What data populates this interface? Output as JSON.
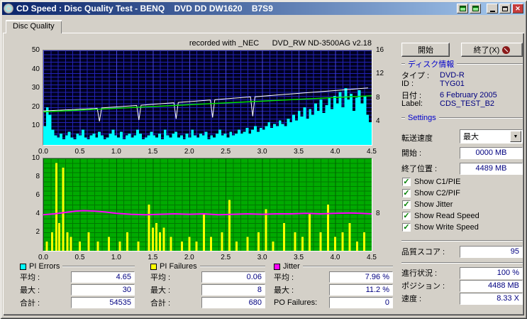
{
  "window": {
    "title": "CD Speed : Disc Quality Test - BENQ    DVD DD DW1620    B7S9",
    "tab": "Disc Quality"
  },
  "annotation": "recorded with _NEC      DVD_RW ND-3500AG v2.18",
  "icons": {
    "close": "✕",
    "check": "✓",
    "combo_arrow": "▼"
  },
  "colors": {
    "titlebar_start": "#0a246a",
    "titlebar_end": "#a6caf0",
    "face": "#d4d0c8",
    "value_navy": "#000080",
    "section_blue": "#0000cc",
    "check_green": "#008000",
    "close_red": "#c43c3c",
    "pi_errors": "#00ffff",
    "pi_failures": "#ffff00",
    "jitter": "#ff00ff",
    "read_speed": "#00e000",
    "write_speed": "#ffffff"
  },
  "chart_data": [
    {
      "type": "bar",
      "title": "PI Errors with read/write speed curves",
      "x_range": [
        0,
        4.5
      ],
      "x_ticks": [
        "0.0",
        "0.5",
        "1.0",
        "1.5",
        "2.0",
        "2.5",
        "3.0",
        "3.5",
        "4.0",
        "4.5"
      ],
      "y_left": {
        "range": [
          0,
          50
        ],
        "ticks": [
          50,
          40,
          30,
          20,
          10
        ]
      },
      "y_right": {
        "range": [
          0,
          16
        ],
        "ticks": [
          16,
          12,
          8,
          4
        ]
      },
      "bg": "#000020",
      "grid": "#2222b4",
      "grid_major": "#4444dc",
      "series": [
        {
          "name": "PI Errors",
          "type": "bar",
          "color": "#00ffff",
          "values": [
            10,
            20,
            16,
            8,
            5,
            4,
            6,
            3,
            5,
            7,
            4,
            3,
            6,
            5,
            8,
            4,
            3,
            5,
            6,
            4,
            7,
            5,
            3,
            4,
            6,
            8,
            5,
            4,
            7,
            3,
            5,
            6,
            4,
            5,
            8,
            6,
            3,
            4,
            5,
            7,
            5,
            4,
            6,
            3,
            8,
            5,
            4,
            6,
            7,
            4,
            5,
            3,
            6,
            4,
            8,
            5,
            4,
            6,
            5,
            7,
            3,
            5,
            4,
            6,
            8,
            5,
            6,
            4,
            7,
            5,
            6,
            8,
            6,
            7,
            9,
            6,
            8,
            10,
            7,
            9,
            8,
            10,
            12,
            9,
            11,
            10,
            13,
            11,
            10,
            14,
            12,
            16,
            13,
            18,
            15,
            20,
            14,
            19,
            16,
            22,
            18,
            24,
            17,
            21,
            25,
            19,
            26,
            22,
            28,
            20,
            30,
            24,
            27,
            18,
            25,
            29,
            22,
            26,
            16,
            12
          ]
        },
        {
          "name": "Write Speed",
          "type": "line",
          "color": "#ffffff",
          "points": [
            [
              0,
              18
            ],
            [
              0.35,
              18.6
            ],
            [
              0.7,
              19.3
            ],
            [
              0.74,
              19.4
            ],
            [
              0.77,
              12.5
            ],
            [
              0.8,
              19.6
            ],
            [
              1.1,
              20.4
            ],
            [
              1.28,
              20.9
            ],
            [
              1.31,
              13.2
            ],
            [
              1.34,
              21.0
            ],
            [
              1.6,
              21.8
            ],
            [
              1.79,
              22.3
            ],
            [
              1.82,
              13.8
            ],
            [
              1.85,
              22.5
            ],
            [
              2.1,
              23.2
            ],
            [
              2.29,
              23.8
            ],
            [
              2.32,
              14.5
            ],
            [
              2.35,
              23.9
            ],
            [
              2.6,
              24.7
            ],
            [
              2.84,
              25.4
            ],
            [
              2.87,
              15.2
            ],
            [
              2.9,
              25.5
            ],
            [
              3.2,
              26.4
            ],
            [
              3.5,
              27.3
            ],
            [
              3.8,
              28.2
            ],
            [
              4.1,
              29.1
            ],
            [
              4.3,
              29.7
            ],
            [
              4.45,
              30.2
            ]
          ]
        },
        {
          "name": "Read Speed",
          "type": "line",
          "color": "#00e000",
          "points": [
            [
              0,
              17.5
            ],
            [
              4.5,
              26
            ]
          ]
        }
      ]
    },
    {
      "type": "bar",
      "title": "PI Failures with jitter curve",
      "x_range": [
        0,
        4.5
      ],
      "x_ticks": [
        "0.0",
        "0.5",
        "1.0",
        "1.5",
        "2.0",
        "2.5",
        "3.0",
        "3.5",
        "4.0",
        "4.5"
      ],
      "y_left": {
        "range": [
          0,
          10
        ],
        "ticks": [
          10,
          8,
          6,
          4,
          2
        ]
      },
      "y_right_labels": [
        {
          "label": "8",
          "frac": 0.4
        }
      ],
      "bg": "#00aa00",
      "grid": "#007800",
      "grid_major": "#006000",
      "series": [
        {
          "name": "PI Failures",
          "type": "xbar",
          "color": "#ffff00",
          "points": [
            [
              0.05,
              1
            ],
            [
              0.12,
              2
            ],
            [
              0.18,
              9.5
            ],
            [
              0.22,
              3
            ],
            [
              0.27,
              9
            ],
            [
              0.33,
              2
            ],
            [
              0.38,
              1.5
            ],
            [
              0.5,
              1
            ],
            [
              0.62,
              2
            ],
            [
              0.75,
              1
            ],
            [
              0.9,
              1.5
            ],
            [
              1.05,
              1
            ],
            [
              1.15,
              2
            ],
            [
              1.3,
              1
            ],
            [
              1.45,
              5
            ],
            [
              1.5,
              2.5
            ],
            [
              1.55,
              3
            ],
            [
              1.6,
              2
            ],
            [
              1.65,
              2.5
            ],
            [
              1.75,
              1.5
            ],
            [
              1.9,
              1
            ],
            [
              2.0,
              1.5
            ],
            [
              2.1,
              1
            ],
            [
              2.2,
              4
            ],
            [
              2.3,
              1.5
            ],
            [
              2.45,
              2
            ],
            [
              2.55,
              5.5
            ],
            [
              2.65,
              1
            ],
            [
              2.8,
              1.5
            ],
            [
              2.95,
              2
            ],
            [
              3.05,
              4.5
            ],
            [
              3.15,
              1
            ],
            [
              3.3,
              3
            ],
            [
              3.45,
              2
            ],
            [
              3.55,
              1.5
            ],
            [
              3.65,
              4
            ],
            [
              3.8,
              2
            ],
            [
              3.9,
              5
            ],
            [
              4.0,
              1.5
            ],
            [
              4.1,
              2
            ],
            [
              4.2,
              3
            ],
            [
              4.3,
              1
            ],
            [
              4.4,
              2
            ]
          ]
        },
        {
          "name": "Jitter",
          "type": "line",
          "color": "#ff00ff",
          "points": [
            [
              0,
              3.9
            ],
            [
              0.15,
              4.0
            ],
            [
              0.3,
              4.15
            ],
            [
              0.45,
              4.3
            ],
            [
              0.55,
              4.35
            ],
            [
              0.7,
              4.3
            ],
            [
              0.85,
              4.2
            ],
            [
              1.0,
              4.05
            ],
            [
              1.2,
              3.95
            ],
            [
              1.4,
              3.9
            ],
            [
              1.6,
              3.95
            ],
            [
              1.8,
              4.0
            ],
            [
              2.0,
              3.95
            ],
            [
              2.2,
              4.0
            ],
            [
              2.4,
              3.9
            ],
            [
              2.6,
              3.95
            ],
            [
              2.8,
              4.0
            ],
            [
              3.0,
              3.95
            ],
            [
              3.2,
              4.0
            ],
            [
              3.4,
              4.0
            ],
            [
              3.6,
              4.05
            ],
            [
              3.8,
              4.0
            ],
            [
              4.0,
              4.05
            ],
            [
              4.2,
              4.1
            ],
            [
              4.35,
              4.05
            ],
            [
              4.5,
              4.0
            ]
          ]
        }
      ]
    }
  ],
  "legend": {
    "groups": [
      {
        "label": "PI Errors",
        "color": "#00ffff",
        "rows": [
          {
            "label": "平均 :",
            "value": "4.65"
          },
          {
            "label": "最大 :",
            "value": "30"
          },
          {
            "label": "合計 :",
            "value": "54535"
          }
        ]
      },
      {
        "label": "PI Failures",
        "color": "#ffff00",
        "rows": [
          {
            "label": "平均 :",
            "value": "0.06"
          },
          {
            "label": "最大 :",
            "value": "8"
          },
          {
            "label": "合計 :",
            "value": "680"
          }
        ]
      },
      {
        "label": "Jitter",
        "color": "#ff00ff",
        "rows": [
          {
            "label": "平均 :",
            "value": "7.96 %"
          },
          {
            "label": "最大 :",
            "value": "11.2 %"
          },
          {
            "label": "PO Failures:",
            "value": "0"
          }
        ]
      }
    ]
  },
  "side": {
    "buttons": {
      "start": "開始",
      "exit": "終了(X)"
    },
    "disc_info": {
      "header": "ディスク情報",
      "rows": [
        {
          "label": "タイプ :",
          "value": "DVD-R"
        },
        {
          "label": "ID :",
          "value": "TYG01"
        },
        {
          "label": "日付 :",
          "value": "6 February 2005"
        },
        {
          "label": "Label:",
          "value": "CDS_TEST_B2"
        }
      ]
    },
    "settings": {
      "header": "Settings",
      "speed_label": "転送速度",
      "speed_value": "最大",
      "start_label": "開始 :",
      "start_value": "0000 MB",
      "end_label": "終了位置 :",
      "end_value": "4489 MB",
      "checkboxes": [
        {
          "label": "Show C1/PIE",
          "checked": true
        },
        {
          "label": "Show C2/PIF",
          "checked": true
        },
        {
          "label": "Show Jitter",
          "checked": true
        },
        {
          "label": "Show Read Speed",
          "checked": true
        },
        {
          "label": "Show Write Speed",
          "checked": true
        }
      ]
    },
    "score": {
      "label": "品質スコア :",
      "value": "95"
    },
    "status": [
      {
        "label": "進行状況 :",
        "value": "100 %"
      },
      {
        "label": "ポジション :",
        "value": "4488 MB"
      },
      {
        "label": "速度 :",
        "value": "8.33 X"
      }
    ]
  }
}
